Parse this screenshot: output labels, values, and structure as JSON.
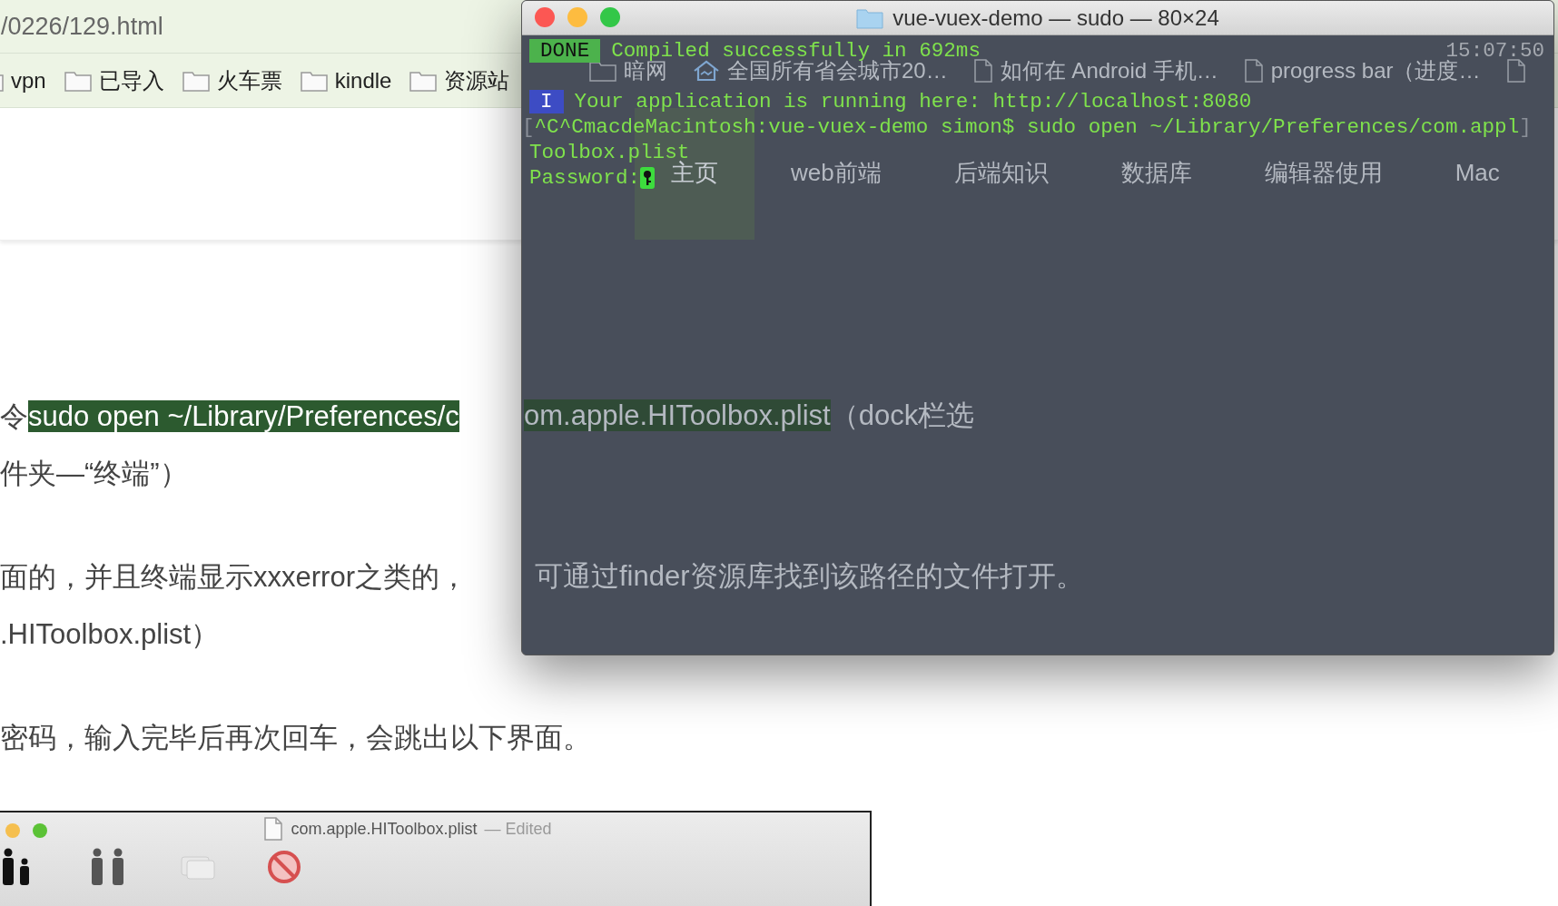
{
  "browser": {
    "url": "/0226/129.html",
    "bookmarks": [
      {
        "kind": "folder",
        "label": "vpn"
      },
      {
        "kind": "folder",
        "label": "已导入"
      },
      {
        "kind": "folder",
        "label": "火车票"
      },
      {
        "kind": "folder",
        "label": "kindle"
      },
      {
        "kind": "folder",
        "label": "资源站"
      }
    ]
  },
  "article": {
    "paragraphs": [
      {
        "lines": [
          {
            "text": "令",
            "highlight": "sudo open ~/Library/Preferences/c"
          },
          {
            "text": "件夹—“终端”）"
          }
        ]
      },
      {
        "lines": [
          {
            "text": "面的，并且终端显示xxxerror之类的，"
          },
          {
            "text": ".HIToolbox.plist）"
          }
        ]
      },
      {
        "lines": [
          {
            "text": "密码，输入完毕后再次回车，会跳出以下界面。"
          }
        ]
      }
    ]
  },
  "embedded_window": {
    "title": "com.apple.HIToolbox.plist",
    "status": "— Edited"
  },
  "terminal": {
    "title": "vue-vuex-demo — sudo — 80×24",
    "behind": {
      "bookmarks": [
        {
          "kind": "folder",
          "label": "暗网"
        },
        {
          "kind": "site",
          "label": "全国所有省会城市20…"
        },
        {
          "kind": "page",
          "label": "如何在 Android 手机…"
        },
        {
          "kind": "page",
          "label": "progress bar（进度…"
        },
        {
          "kind": "page"
        }
      ],
      "site_nav": [
        {
          "label": "主页",
          "selected": true
        },
        {
          "label": "web前端",
          "selected": false
        },
        {
          "label": "后端知识",
          "selected": false
        },
        {
          "label": "数据库",
          "selected": false
        },
        {
          "label": "编辑器使用",
          "selected": false
        },
        {
          "label": "Mac",
          "selected": false
        }
      ],
      "lines": [
        {
          "highlight": "om.apple.HIToolbox.plist",
          "after": "（dock栏选"
        },
        {
          "text": "可通过finder资源库找到该路径的文件打开。"
        }
      ]
    },
    "lines": [
      {
        "kind": "status",
        "badge": "DONE",
        "color": "#4cb24c",
        "text": "Compiled successfully in 692ms",
        "time": "15:07:50"
      },
      {
        "kind": "info",
        "badge": "I",
        "color": "#3d4cc4",
        "text": "Your application is running here: http://localhost:8080"
      },
      {
        "kind": "command",
        "prefix": "[",
        "text": "^C^CmacdeMacintosh:vue-vuex-demo simon$ sudo open ~/Library/Preferences/com.appl",
        "suffix": "]"
      },
      {
        "kind": "plain",
        "text": "Toolbox.plist"
      },
      {
        "kind": "prompt",
        "text": "Password:"
      }
    ]
  }
}
